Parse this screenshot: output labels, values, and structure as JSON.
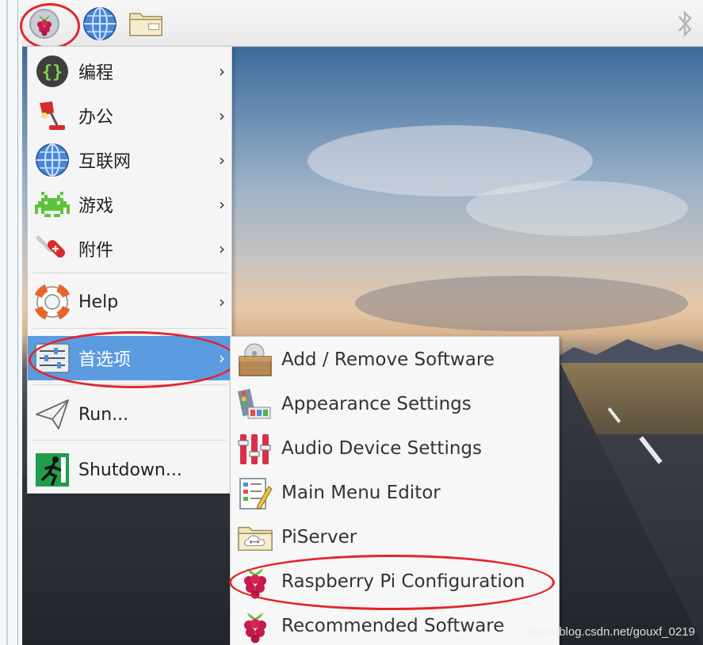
{
  "taskbar": {
    "buttons": [
      {
        "icon": "raspberry-icon",
        "label": "Menu"
      },
      {
        "icon": "globe-icon",
        "label": "Web Browser"
      },
      {
        "icon": "folder-icon",
        "label": "File Manager"
      },
      {
        "icon": "bluetooth-icon",
        "label": "Bluetooth"
      }
    ]
  },
  "main_menu": {
    "items": [
      {
        "label": "编程",
        "icon": "programming-icon",
        "has_submenu": true
      },
      {
        "label": "办公",
        "icon": "office-lamp-icon",
        "has_submenu": true
      },
      {
        "label": "互联网",
        "icon": "globe-icon",
        "has_submenu": true
      },
      {
        "label": "游戏",
        "icon": "space-invader-icon",
        "has_submenu": true
      },
      {
        "label": "附件",
        "icon": "swiss-knife-icon",
        "has_submenu": true
      },
      {
        "label": "Help",
        "icon": "lifebuoy-icon",
        "has_submenu": true
      },
      {
        "label": "首选项",
        "icon": "preferences-sliders-icon",
        "has_submenu": true,
        "active": true
      },
      {
        "label": "Run...",
        "icon": "paper-plane-icon",
        "has_submenu": false
      },
      {
        "label": "Shutdown...",
        "icon": "exit-running-man-icon",
        "has_submenu": false
      }
    ],
    "arrow": "›"
  },
  "submenu_preferences": {
    "items": [
      {
        "label": "Add / Remove Software",
        "icon": "package-cd-icon"
      },
      {
        "label": "Appearance Settings",
        "icon": "palette-icon"
      },
      {
        "label": "Audio Device Settings",
        "icon": "audio-mixer-icon"
      },
      {
        "label": "Main Menu Editor",
        "icon": "menu-editor-icon"
      },
      {
        "label": "PiServer",
        "icon": "cloud-folder-icon"
      },
      {
        "label": "Raspberry Pi Configuration",
        "icon": "raspberry-icon"
      },
      {
        "label": "Recommended Software",
        "icon": "raspberry-icon"
      }
    ]
  },
  "watermark": "https://blog.csdn.net/gouxf_0219",
  "colors": {
    "active_highlight": "#5b9be0",
    "annotation_red": "#e3252a",
    "raspberry_red": "#c51a4a",
    "leaf_green": "#6cc04a"
  }
}
